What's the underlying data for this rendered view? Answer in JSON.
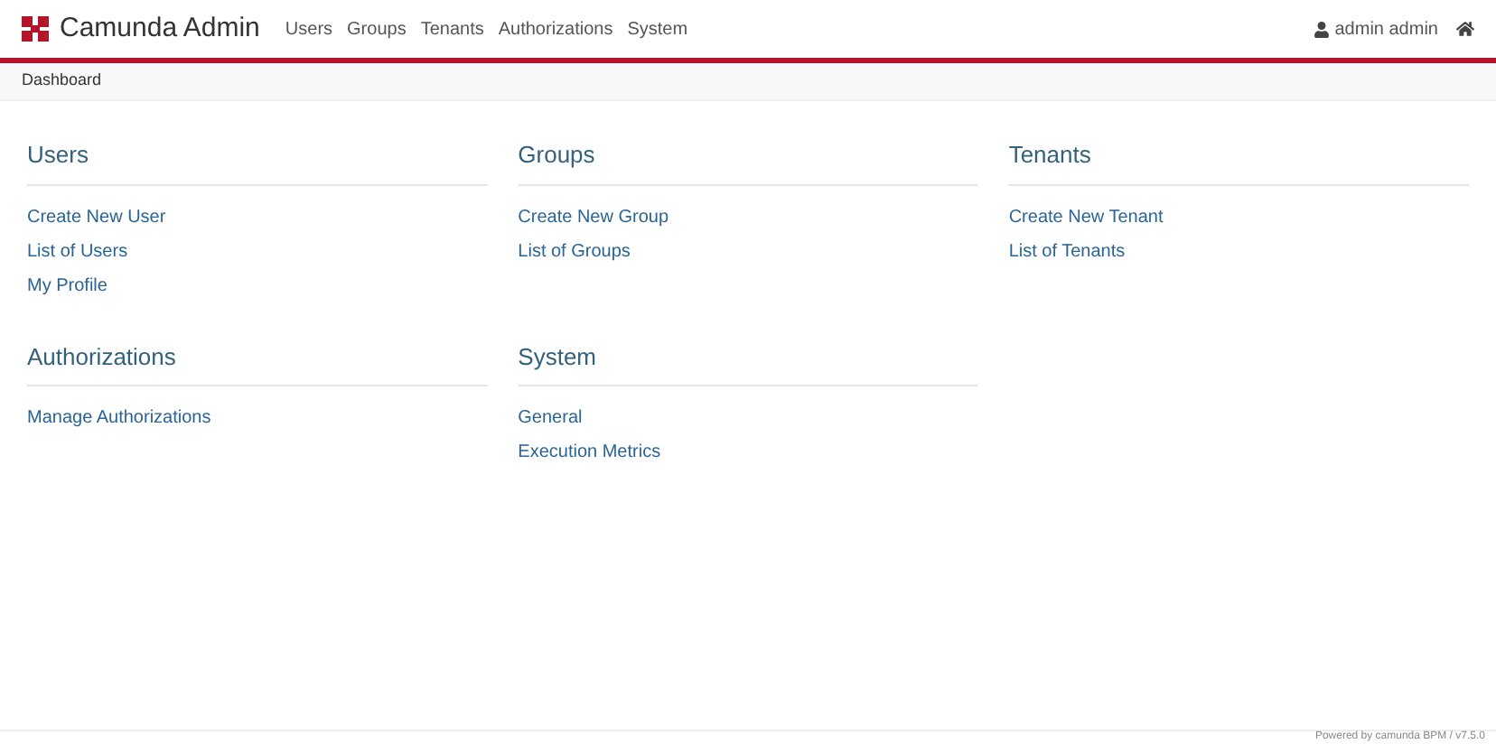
{
  "brand": {
    "title": "Camunda Admin"
  },
  "nav": [
    "Users",
    "Groups",
    "Tenants",
    "Authorizations",
    "System"
  ],
  "user_menu": {
    "label": "admin admin"
  },
  "breadcrumb": [
    "Dashboard"
  ],
  "sections": [
    {
      "title": "Users",
      "links": [
        "Create New User",
        "List of Users",
        "My Profile"
      ]
    },
    {
      "title": "Groups",
      "links": [
        "Create New Group",
        "List of Groups"
      ]
    },
    {
      "title": "Tenants",
      "links": [
        "Create New Tenant",
        "List of Tenants"
      ]
    },
    {
      "title": "Authorizations",
      "links": [
        "Manage Authorizations"
      ]
    },
    {
      "title": "System",
      "links": [
        "General",
        "Execution Metrics"
      ]
    }
  ],
  "footer": {
    "text": "Powered by camunda BPM / v7.5.0"
  }
}
